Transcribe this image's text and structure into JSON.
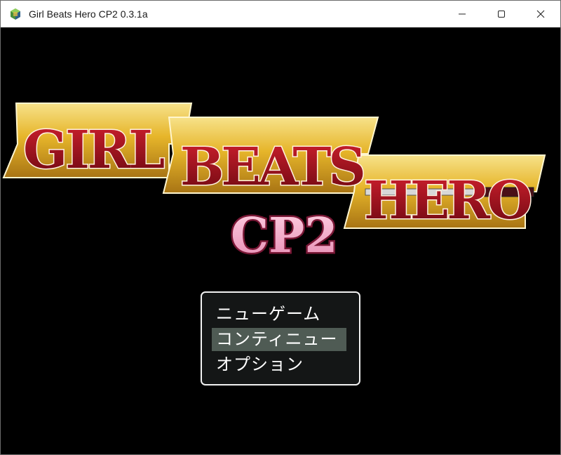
{
  "window": {
    "title": "Girl Beats Hero CP2 0.3.1a"
  },
  "logo": {
    "word1": "GIRL",
    "word2": "BEATS",
    "word3": "HERO",
    "subtitle": "CP2"
  },
  "menu": {
    "items": [
      {
        "label": "ニューゲーム",
        "selected": false
      },
      {
        "label": "コンティニュー",
        "selected": true
      },
      {
        "label": "オプション",
        "selected": false
      }
    ]
  },
  "colors": {
    "title_red": "#a0101c",
    "banner_gold": "#e6b52a",
    "subtitle_pink": "#ee9bbd"
  }
}
